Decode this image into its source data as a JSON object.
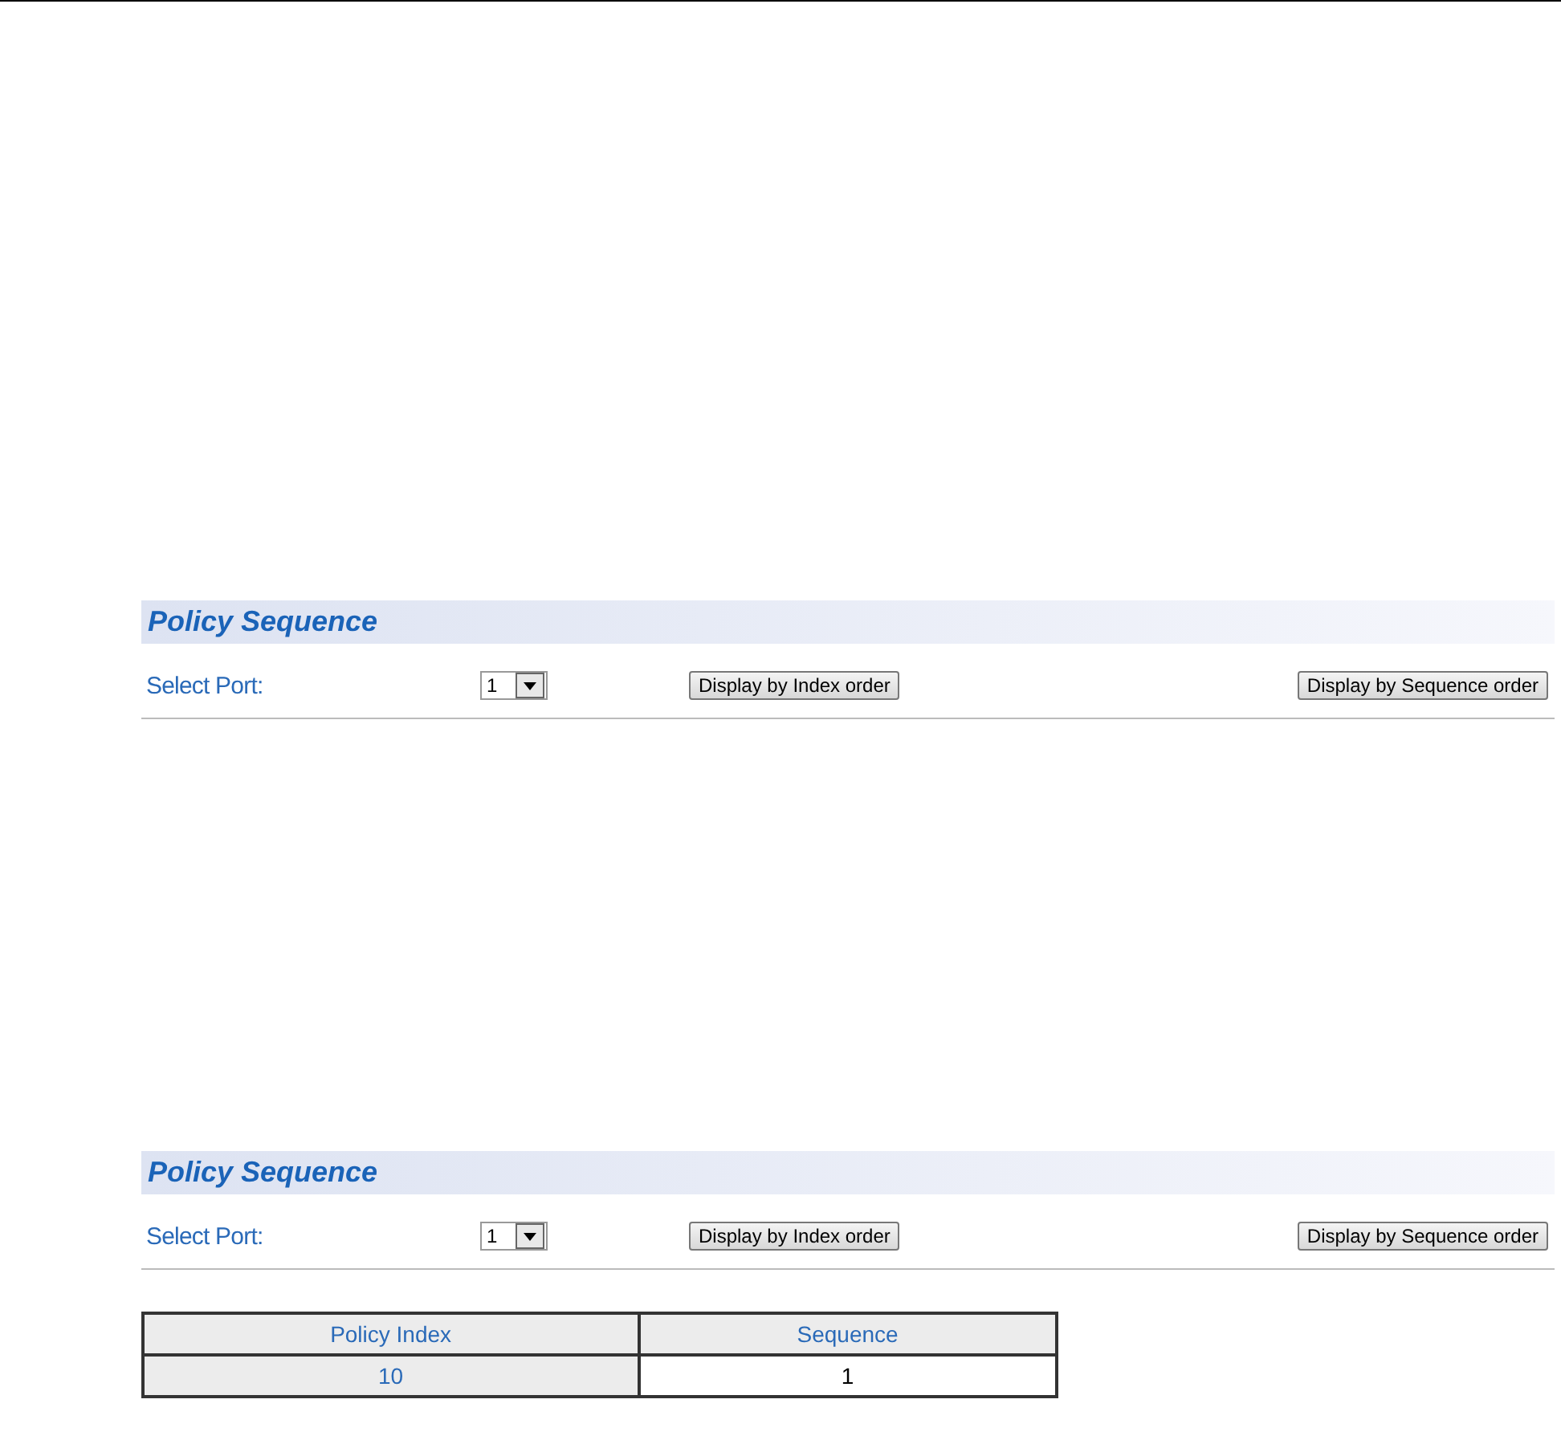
{
  "panels": [
    {
      "title": "Policy Sequence",
      "port_label": "Select Port:",
      "port_value": "1",
      "buttons": [
        "Display by Index order",
        "Display by Sequence order"
      ]
    },
    {
      "title": "Policy Sequence",
      "port_label": "Select Port:",
      "port_value": "1",
      "buttons": [
        "Display by Index order",
        "Display by Sequence order"
      ],
      "table": {
        "columns": [
          "Policy Index",
          "Sequence"
        ],
        "rows": [
          [
            "10",
            "1"
          ]
        ]
      }
    }
  ]
}
